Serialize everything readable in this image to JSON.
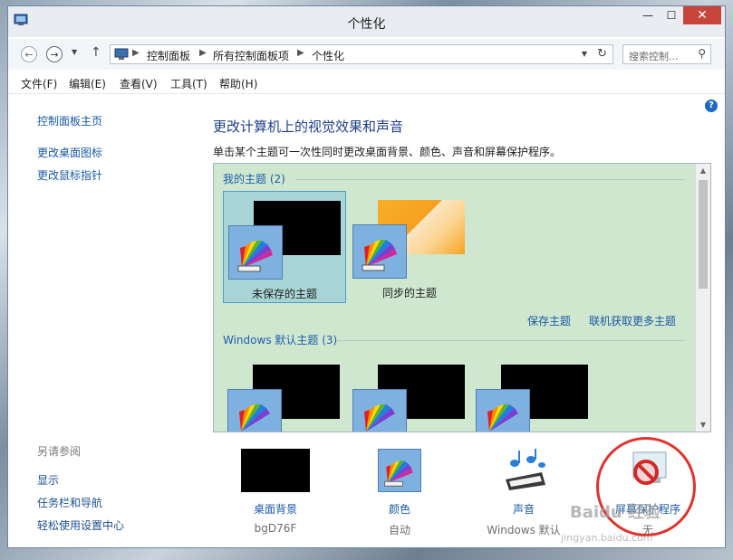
{
  "window": {
    "title": "个性化"
  },
  "address": {
    "crumbs": [
      "控制面板",
      "所有控制面板项",
      "个性化"
    ],
    "search_placeholder": "搜索控制..."
  },
  "menu": [
    "文件(F)",
    "编辑(E)",
    "查看(V)",
    "工具(T)",
    "帮助(H)"
  ],
  "sidebar": {
    "home": "控制面板主页",
    "links": [
      "更改桌面图标",
      "更改鼠标指针"
    ],
    "see_also_title": "另请参阅",
    "see_also": [
      "显示",
      "任务栏和导航",
      "轻松使用设置中心"
    ]
  },
  "main": {
    "heading": "更改计算机上的视觉效果和声音",
    "description": "单击某个主题可一次性同时更改桌面背景、颜色、声音和屏幕保护程序。",
    "my_themes_title": "我的主题 (2)",
    "my_themes": [
      {
        "label": "未保存的主题"
      },
      {
        "label": "同步的主题"
      }
    ],
    "save_theme": "保存主题",
    "get_more": "联机获取更多主题",
    "windows_themes_title": "Windows 默认主题 (3)"
  },
  "bottom": [
    {
      "label": "桌面背景",
      "value": "bgD76F",
      "icon": "desktop-background-thumb"
    },
    {
      "label": "颜色",
      "value": "自动",
      "icon": "color-palette-icon"
    },
    {
      "label": "声音",
      "value": "Windows 默认",
      "icon": "sound-music-icon"
    },
    {
      "label": "屏幕保护程序",
      "value": "无",
      "icon": "screensaver-none-icon"
    }
  ],
  "colors": {
    "accent": "#1a5aa6",
    "panel_bg": "#cfe6cf",
    "close_btn": "#c7453a",
    "highlight_circle": "#e0332d"
  },
  "watermark": {
    "text": "Baidu 经验",
    "url": "jingyan.baidu.com"
  }
}
